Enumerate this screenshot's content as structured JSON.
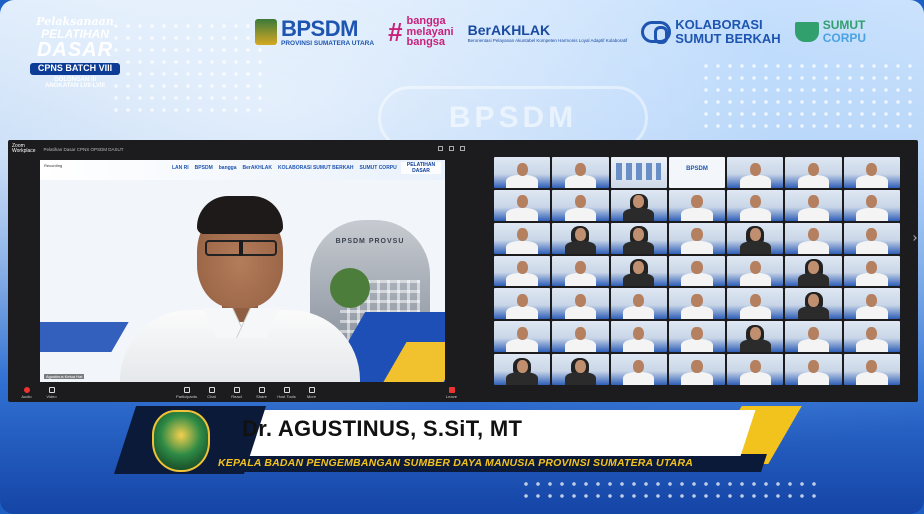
{
  "badge": {
    "line1": "Pelaksanaan",
    "line2": "PELATIHAN",
    "line3": "DASAR",
    "line4": "CPNS BATCH VIII",
    "line5": "GOLONGAN III",
    "line6": "ANGKATAN LVII-LVIII"
  },
  "logos": {
    "bpsdm": "BPSDM",
    "bpsdm_sub": "PROVINSI SUMATERA UTARA",
    "bangga": [
      "bangga",
      "melayani",
      "bangsa"
    ],
    "berakhlak": "BerAKHLAK",
    "berakhlak_sub": "Berorientasi Pelayanan Akuntabel Kompeten Harmonis Loyal Adaptif Kolaboratif",
    "kolaborasi": [
      "KOLABORASI",
      "SUMUT BERKAH"
    ],
    "corpu": [
      "SUMUT",
      "CORPU"
    ]
  },
  "watermark": "BPSDM PROVSU",
  "zoom": {
    "workplace_label": [
      "Zoom",
      "Workplace"
    ],
    "window_title": "Pelatihan Dasar CPNS OPSDM DASUT",
    "speaker_top_tag": "Recording",
    "speaker_label": "Agustinus Ketua Hat",
    "vbg_logos": [
      "LAN RI",
      "BPSDM",
      "bangga",
      "BerAKHLAK",
      "KOLABORASI SUMUT BERKAH",
      "SUMUT CORPU"
    ],
    "vbg_badge": "PELATIHAN DASAR",
    "vbg_gate": "BPSDM PROVSU",
    "toolbar": {
      "audio": "Audio",
      "video": "Video",
      "participants": "Participants",
      "chat": "Chat",
      "react": "React",
      "share": "Share",
      "host_tools": "Host Tools",
      "more": "More",
      "leave": "Leave"
    }
  },
  "gallery_tiles": [
    "p",
    "p",
    "screen",
    "bpsdm",
    "p",
    "p",
    "p",
    "p",
    "p",
    "hijab",
    "p",
    "p",
    "p",
    "p",
    "p",
    "hijab",
    "hijab",
    "p",
    "hijab",
    "p",
    "p",
    "p",
    "p",
    "hijab",
    "p",
    "p",
    "hijab",
    "p",
    "p",
    "p",
    "p",
    "p",
    "p",
    "hijab",
    "p",
    "p",
    "p",
    "p",
    "p",
    "hijab",
    "p",
    "p",
    "hijab",
    "hijab",
    "p",
    "p",
    "p",
    "p",
    "p"
  ],
  "lower_third": {
    "name": "Dr. AGUSTINUS, S.SiT, MT",
    "title": "KEPALA BADAN PENGEMBANGAN SUMBER DAYA MANUSIA PROVINSI SUMATERA UTARA"
  },
  "colors": {
    "brand_blue": "#1e55b0",
    "accent_yellow": "#f3c31d",
    "dark_navy": "#0c1a3a",
    "magenta": "#c9207a",
    "green": "#31a06c"
  }
}
